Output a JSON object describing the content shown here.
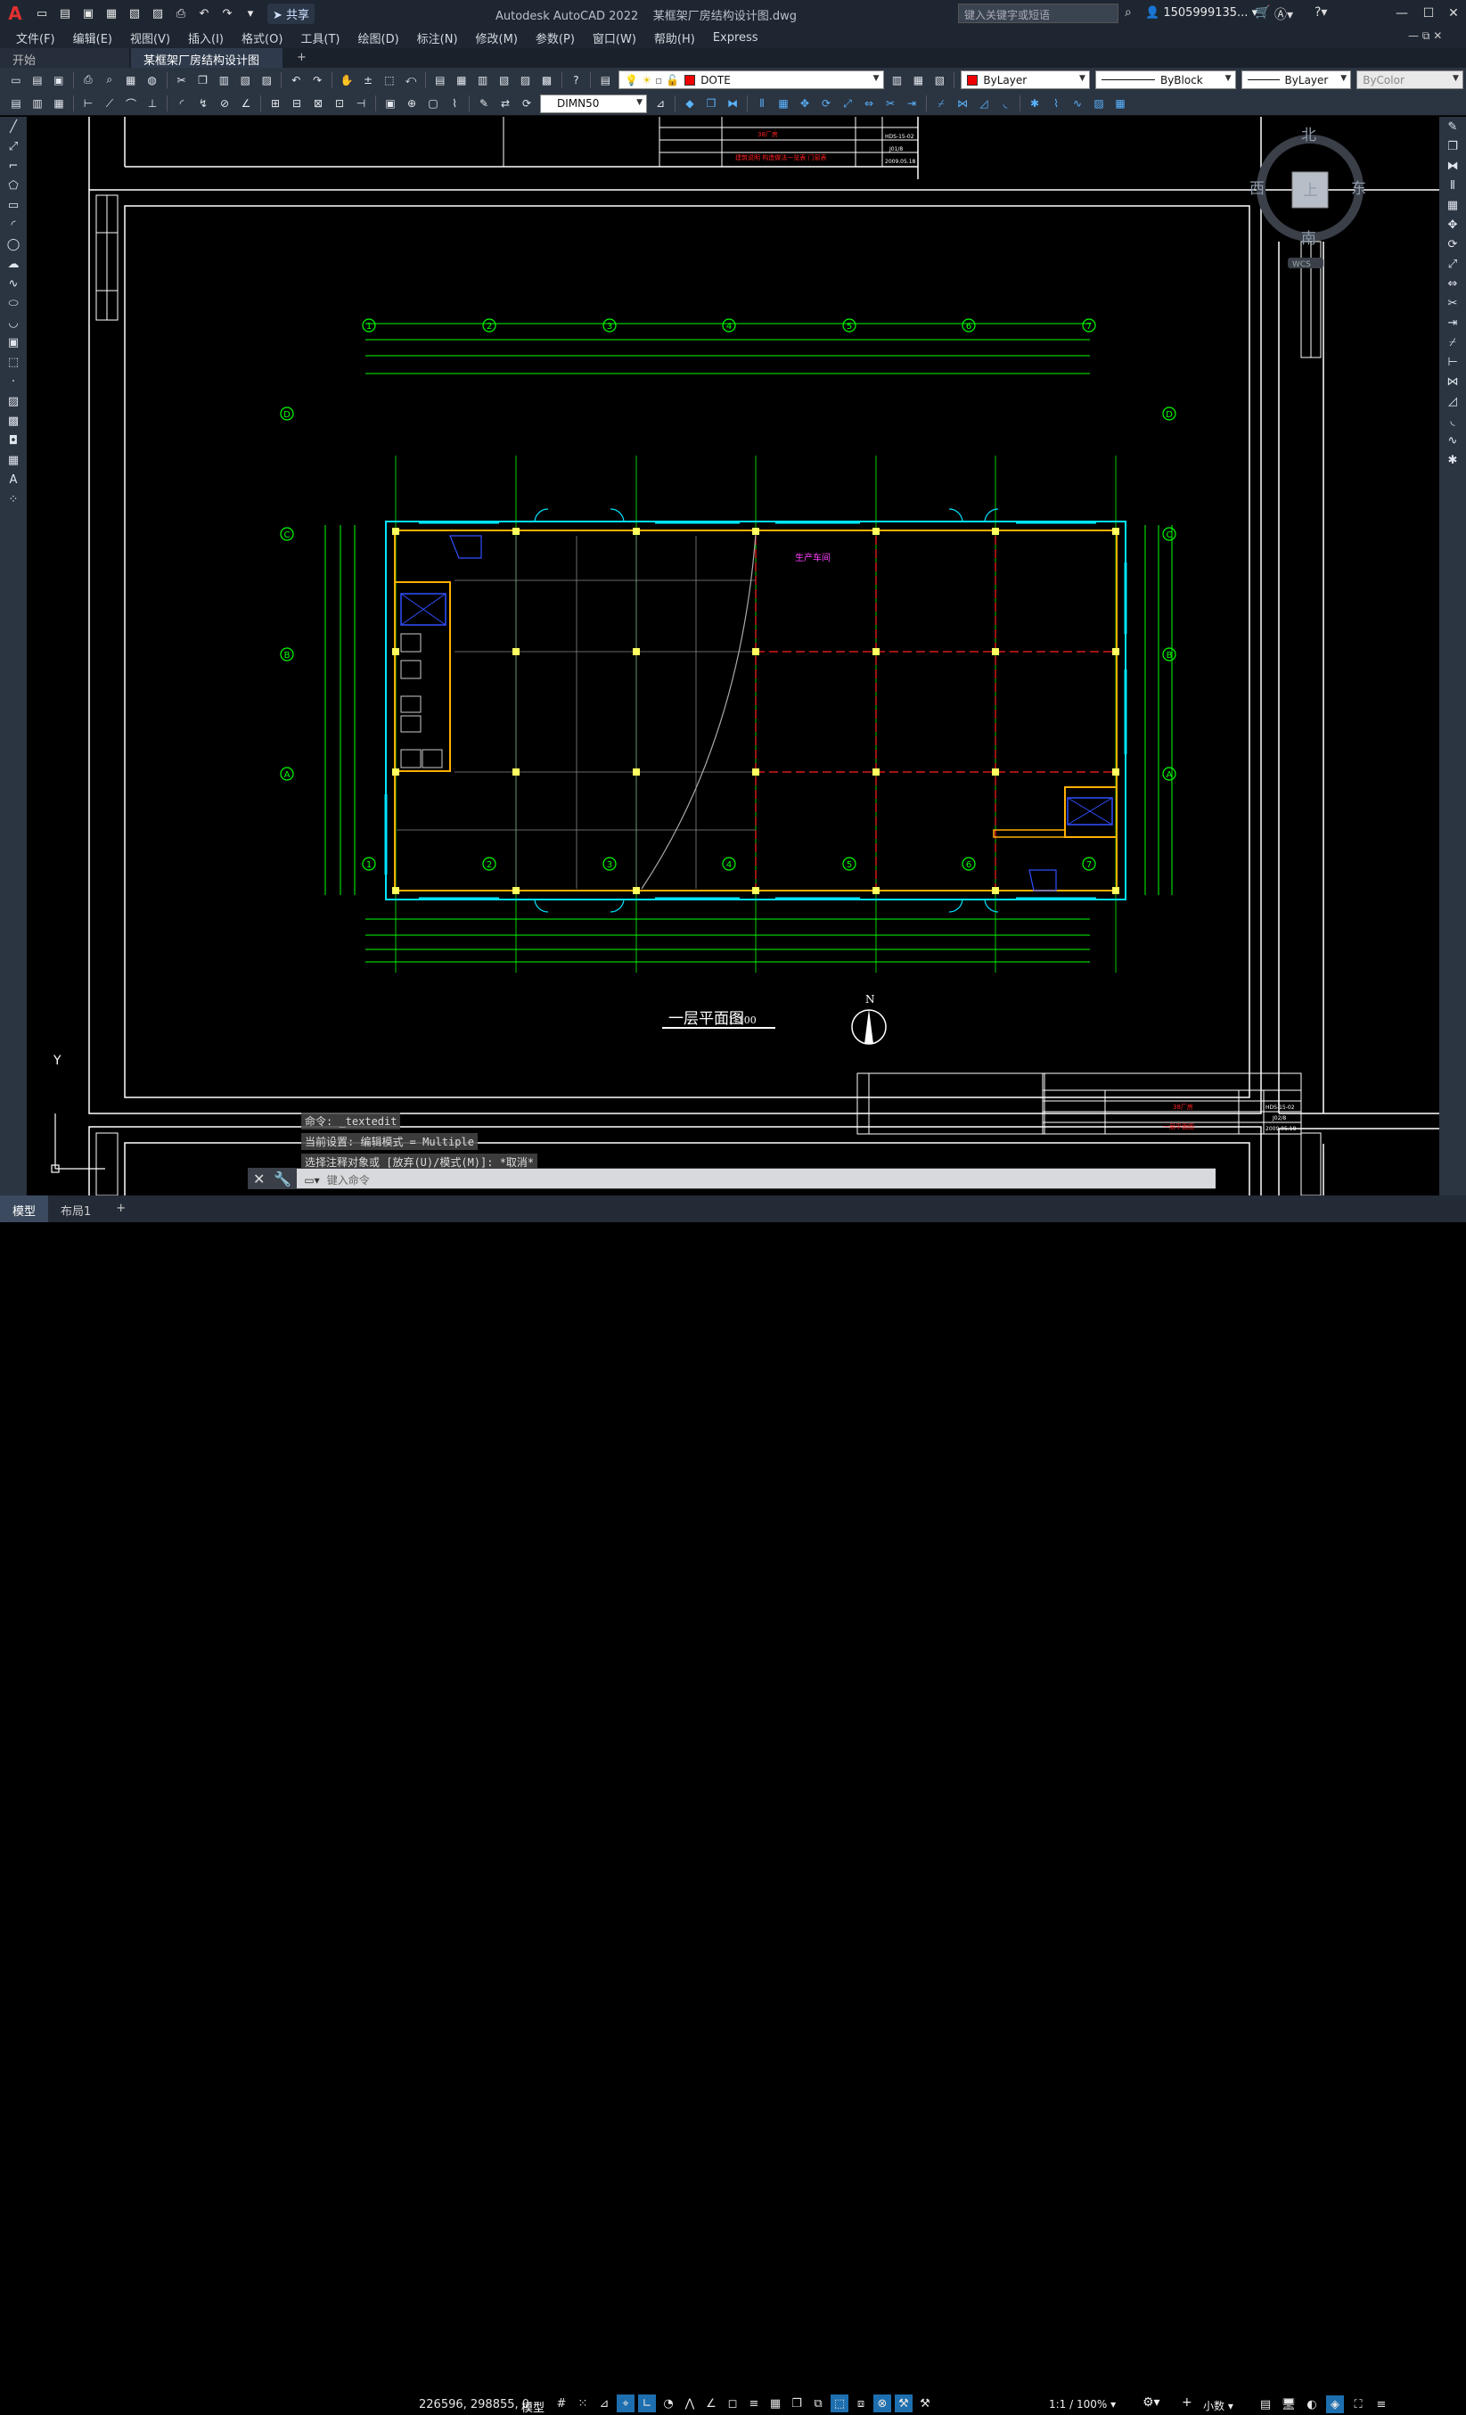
{
  "app": {
    "title": "Autodesk AutoCAD 2022",
    "file": "某框架厂房结构设计图.dwg",
    "share_label": "共享",
    "search_placeholder": "键入关键字或短语",
    "user": "1505999135..."
  },
  "menu": [
    "文件(F)",
    "编辑(E)",
    "视图(V)",
    "插入(I)",
    "格式(O)",
    "工具(T)",
    "绘图(D)",
    "标注(N)",
    "修改(M)",
    "参数(P)",
    "窗口(W)",
    "帮助(H)",
    "Express"
  ],
  "tabs": [
    {
      "label": "开始"
    },
    {
      "label": "某框架厂房结构设计图*"
    }
  ],
  "toolbar": {
    "layer": "DOTE",
    "color": "ByLayer",
    "linetype": "ByBlock",
    "lineweight": "ByLayer",
    "plotstyle": "ByColor",
    "dimstyle": "DIMN50"
  },
  "viewcube": {
    "north": "北",
    "south": "南",
    "east": "东",
    "west": "西",
    "top": "上",
    "wcs": "WCS"
  },
  "drawing": {
    "plan_title": "一层平面图",
    "plan_scale": "1:100",
    "north_label": "N",
    "room_label": "生产车间",
    "axis_numbers": [
      "1",
      "2",
      "3",
      "4",
      "5",
      "6",
      "7"
    ],
    "axis_letters": [
      "D",
      "C",
      "B",
      "A"
    ],
    "title_block": {
      "project": "38厂房",
      "drawing_no": "HDS-15-02",
      "sheet": "J01/8",
      "date": "2009.05.18",
      "drawing_name": "一层平面图",
      "sheet2": "J02/8",
      "top_sheet_name": "建筑说明 构造做法一览表 门窗表"
    }
  },
  "command": {
    "history": [
      "命令: _textedit",
      "当前设置: 编辑模式 = Multiple",
      "选择注释对象或 [放弃(U)/模式(M)]: *取消*"
    ],
    "placeholder": "键入命令"
  },
  "status": {
    "layouts": [
      "模型",
      "布局1"
    ],
    "coords": "226596, 298855, 0",
    "space": "模型",
    "scale": "1:1 / 100%",
    "units": "小数"
  }
}
